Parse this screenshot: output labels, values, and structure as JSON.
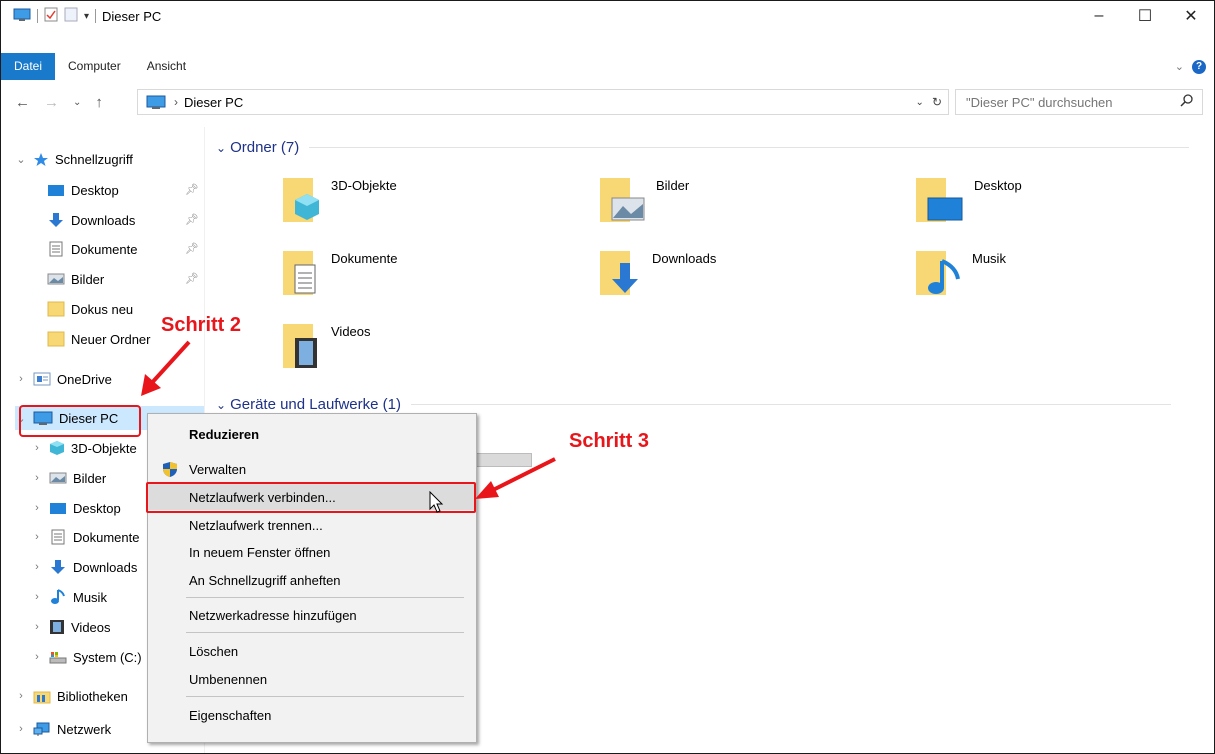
{
  "window": {
    "title": "Dieser PC",
    "controls": {
      "minimize": "–",
      "maximize": "☐",
      "close": "✕"
    }
  },
  "ribbon": {
    "tabs": [
      {
        "label": "Datei",
        "active": true
      },
      {
        "label": "Computer",
        "active": false
      },
      {
        "label": "Ansicht",
        "active": false
      }
    ],
    "help_label": "?"
  },
  "address_bar": {
    "crumb": "Dieser PC",
    "search_placeholder": "\"Dieser PC\" durchsuchen"
  },
  "nav_pane": {
    "quick_access": "Schnellzugriff",
    "quick_items": [
      "Desktop",
      "Downloads",
      "Dokumente",
      "Bilder",
      "Dokus neu",
      "Neuer Ordner"
    ],
    "onedrive": "OneDrive",
    "this_pc": "Dieser PC",
    "this_pc_items": [
      "3D-Objekte",
      "Bilder",
      "Desktop",
      "Dokumente",
      "Downloads",
      "Musik",
      "Videos",
      "System (C:)"
    ],
    "libraries": "Bibliotheken",
    "network": "Netzwerk"
  },
  "content": {
    "folders_header": "Ordner (7)",
    "folders": [
      "3D-Objekte",
      "Bilder",
      "Desktop",
      "Dokumente",
      "Downloads",
      "Musik",
      "Videos"
    ],
    "devices_header": "Geräte und Laufwerke (1)"
  },
  "annotations": {
    "step2": "Schritt 2",
    "step3": "Schritt 3"
  },
  "context_menu": {
    "items": [
      "Reduzieren",
      "Verwalten",
      "Netzlaufwerk verbinden...",
      "Netzlaufwerk trennen...",
      "In neuem Fenster öffnen",
      "An Schnellzugriff anheften",
      "Netzwerkadresse hinzufügen",
      "Löschen",
      "Umbenennen",
      "Eigenschaften"
    ],
    "highlighted_item": "Netzlaufwerk verbinden..."
  },
  "colors": {
    "accent": "#1979ca",
    "selection": "#cce8ff",
    "annotation_red": "#e8161b",
    "group_header": "#1e3287",
    "folder_yellow": "#f8d775"
  }
}
